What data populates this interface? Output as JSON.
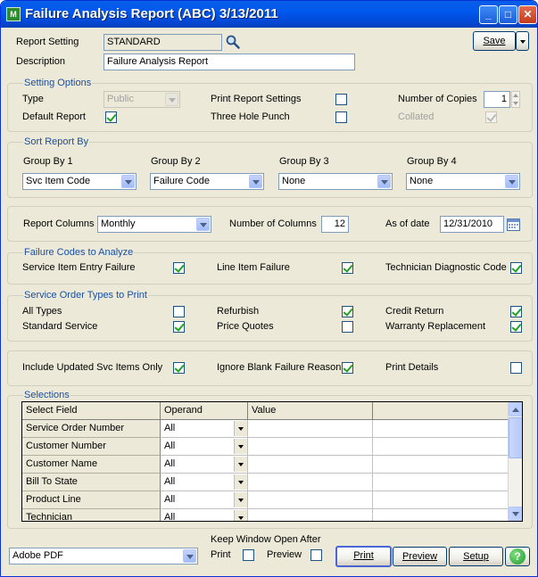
{
  "window": {
    "title": "Failure Analysis Report (ABC) 3/13/2011",
    "app_icon_text": "M"
  },
  "header": {
    "report_setting_label": "Report Setting",
    "report_setting_value": "STANDARD",
    "description_label": "Description",
    "description_value": "Failure Analysis Report",
    "save_label": "Save"
  },
  "setting_options": {
    "title": "Setting Options",
    "type_label": "Type",
    "type_value": "Public",
    "default_report_label": "Default Report",
    "default_report_checked": true,
    "print_report_settings_label": "Print Report Settings",
    "print_report_settings_checked": false,
    "three_hole_punch_label": "Three Hole Punch",
    "three_hole_punch_checked": false,
    "number_of_copies_label": "Number of Copies",
    "number_of_copies_value": "1",
    "collated_label": "Collated",
    "collated_checked": true
  },
  "sort_report_by": {
    "title": "Sort Report By",
    "groups": [
      {
        "label": "Group By 1",
        "value": "Svc Item Code"
      },
      {
        "label": "Group By 2",
        "value": "Failure Code"
      },
      {
        "label": "Group By 3",
        "value": "None"
      },
      {
        "label": "Group By 4",
        "value": "None"
      }
    ]
  },
  "columns": {
    "report_columns_label": "Report Columns",
    "report_columns_value": "Monthly",
    "number_of_columns_label": "Number of Columns",
    "number_of_columns_value": "12",
    "as_of_date_label": "As of date",
    "as_of_date_value": "12/31/2010"
  },
  "failure_codes": {
    "title": "Failure Codes to Analyze",
    "service_item_entry_failure_label": "Service Item Entry Failure",
    "service_item_entry_failure_checked": true,
    "line_item_failure_label": "Line Item Failure",
    "line_item_failure_checked": true,
    "technician_diagnostic_code_label": "Technician Diagnostic Code",
    "technician_diagnostic_code_checked": true
  },
  "service_order_types": {
    "title": "Service Order Types to Print",
    "all_types_label": "All Types",
    "all_types_checked": false,
    "refurbish_label": "Refurbish",
    "refurbish_checked": true,
    "credit_return_label": "Credit Return",
    "credit_return_checked": true,
    "standard_service_label": "Standard Service",
    "standard_service_checked": true,
    "price_quotes_label": "Price Quotes",
    "price_quotes_checked": false,
    "warranty_replacement_label": "Warranty Replacement",
    "warranty_replacement_checked": true
  },
  "options": {
    "include_updated_label": "Include Updated Svc Items Only",
    "include_updated_checked": true,
    "ignore_blank_label": "Ignore Blank Failure Reason",
    "ignore_blank_checked": true,
    "print_details_label": "Print Details",
    "print_details_checked": false
  },
  "selections": {
    "title": "Selections",
    "headers": [
      "Select Field",
      "Operand",
      "Value",
      ""
    ],
    "rows": [
      {
        "field": "Service Order Number",
        "operand": "All"
      },
      {
        "field": "Customer Number",
        "operand": "All"
      },
      {
        "field": "Customer Name",
        "operand": "All"
      },
      {
        "field": "Bill To State",
        "operand": "All"
      },
      {
        "field": "Product Line",
        "operand": "All"
      },
      {
        "field": "Technician",
        "operand": "All"
      }
    ]
  },
  "footer": {
    "printer_value": "Adobe PDF",
    "keep_window_open_label": "Keep Window Open After",
    "keep_print_label": "Print",
    "keep_print_checked": false,
    "keep_preview_label": "Preview",
    "keep_preview_checked": false,
    "print_button_label": "Print",
    "preview_button_label": "Preview",
    "setup_button_label": "Setup",
    "help_glyph": "?"
  }
}
